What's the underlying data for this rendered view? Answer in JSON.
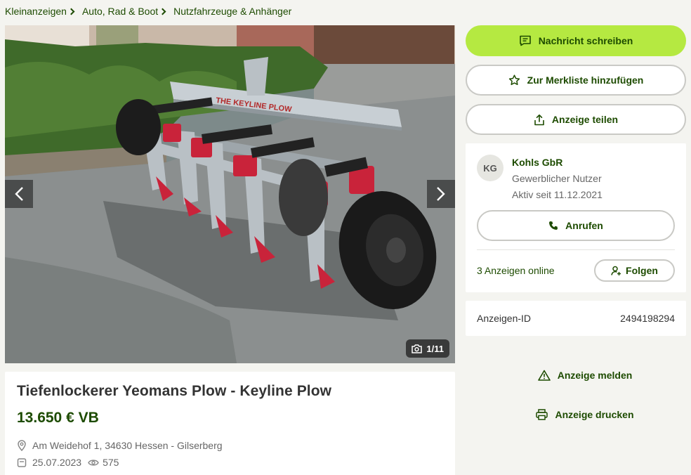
{
  "breadcrumb": [
    "Kleinanzeigen",
    "Auto, Rad & Boot",
    "Nutzfahrzeuge & Anhänger"
  ],
  "gallery": {
    "counter": "1/11",
    "prev_icon": "chevron-left-icon",
    "next_icon": "chevron-right-icon",
    "camera_icon": "camera-icon"
  },
  "listing": {
    "title": "Tiefenlockerer Yeomans Plow - Keyline Plow",
    "price": "13.650 € VB",
    "location": "Am Weidehof 1, 34630 Hessen - Gilserberg",
    "date": "25.07.2023",
    "views": "575"
  },
  "actions": {
    "message": "Nachricht schreiben",
    "watchlist": "Zur Merkliste hinzufügen",
    "share": "Anzeige teilen",
    "report": "Anzeige melden",
    "print": "Anzeige drucken"
  },
  "seller": {
    "initials": "KG",
    "name": "Kohls GbR",
    "type": "Gewerblicher Nutzer",
    "active_since": "Aktiv seit 11.12.2021",
    "call": "Anrufen",
    "ads_online": "3 Anzeigen online",
    "follow": "Folgen"
  },
  "ad_id": {
    "label": "Anzeigen-ID",
    "value": "2494198294"
  },
  "colors": {
    "accent": "#b5e941",
    "brand_text": "#1d4b00",
    "background": "#f4f4f0"
  }
}
